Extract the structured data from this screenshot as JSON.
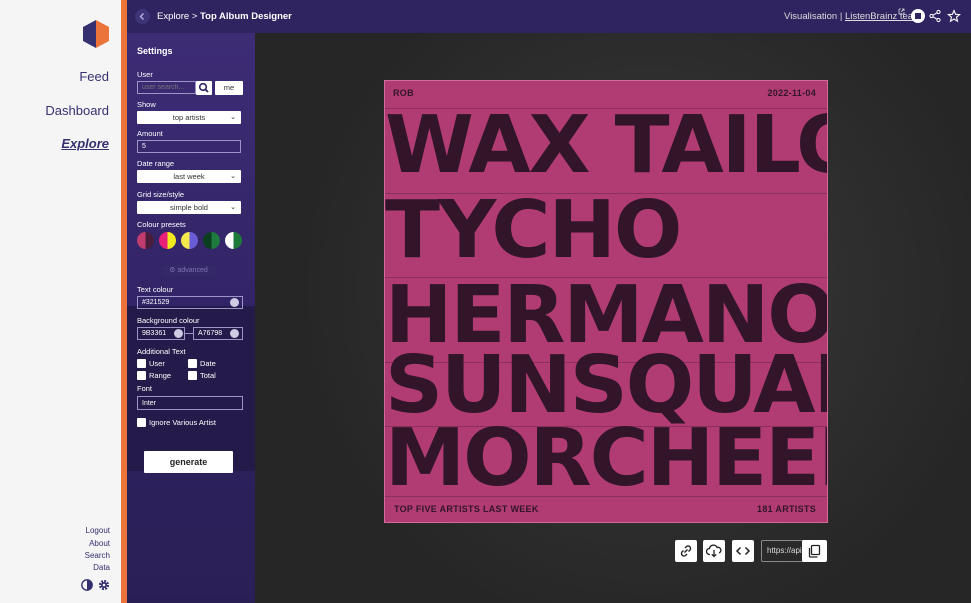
{
  "nav": {
    "feed": "Feed",
    "dashboard": "Dashboard",
    "explore": "Explore",
    "footer": [
      "Logout",
      "About",
      "Search",
      "Data"
    ]
  },
  "header": {
    "back_icon": "chevron-left-icon",
    "crumb_parent": "Explore >",
    "crumb_current": "Top Album Designer",
    "right_prefix": "Visualisation |",
    "right_link": "ListenBrainz team",
    "icons": [
      "external-link-icon",
      "stop-icon",
      "share-icon",
      "star-icon"
    ]
  },
  "settings": {
    "title": "Settings",
    "user_label": "User",
    "user_placeholder": "user search...",
    "me_button": "me",
    "show_label": "Show",
    "show_value": "top artists",
    "amount_label": "Amount",
    "amount_value": "5",
    "date_range_label": "Date range",
    "date_range_value": "last week",
    "grid_label": "Grid size/style",
    "grid_value": "simple bold",
    "presets_label": "Colour presets",
    "presets": [
      [
        "#c13c6e",
        "#4a1d3c"
      ],
      [
        "#e8207a",
        "#f0ea1e"
      ],
      [
        "#f2e94e",
        "#6a5bd6"
      ],
      [
        "#0b3d1f",
        "#1e7a3e"
      ],
      [
        "#ffffff",
        "#1d7a3a"
      ]
    ],
    "advanced_label": "advanced",
    "text_colour_label": "Text colour",
    "text_colour_value": "#321529",
    "bg_colour_label": "Background colour",
    "bg_colour_from": "9B3361",
    "bg_colour_to": "A76798",
    "additional_text_label": "Additional Text",
    "cb_user": "User",
    "cb_date": "Date",
    "cb_range": "Range",
    "cb_total": "Total",
    "font_label": "Font",
    "font_value": "Inter",
    "ignore_various": "Ignore Various Artist",
    "generate": "generate"
  },
  "album": {
    "user": "ROB",
    "date": "2022-11-04",
    "artists": [
      "WAX TAILOR",
      "TYCHO",
      "HERMANOS",
      "SUNSQUABI",
      "MORCHEEBA"
    ],
    "footer_left": "TOP FIVE ARTISTS LAST WEEK",
    "footer_right": "181 ARTISTS",
    "text_color": "#321529",
    "bg_color": "#b03c73"
  },
  "toolbar": {
    "icons": [
      "link-icon",
      "cloud-download-icon",
      "code-icon"
    ],
    "url_value": "https://api.listenbrainz.org",
    "copy_icon": "copy-icon"
  }
}
